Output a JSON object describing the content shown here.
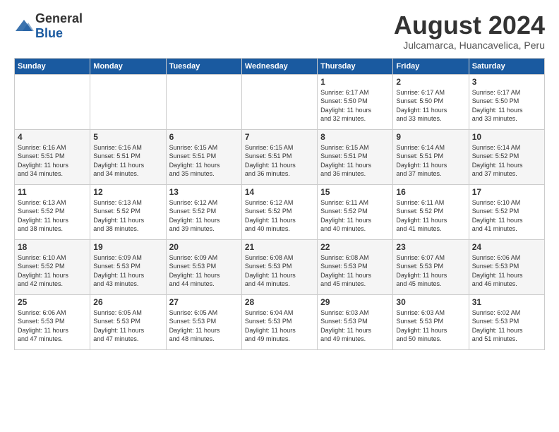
{
  "logo": {
    "general": "General",
    "blue": "Blue"
  },
  "header": {
    "month": "August 2024",
    "location": "Julcamarca, Huancavelica, Peru"
  },
  "days_of_week": [
    "Sunday",
    "Monday",
    "Tuesday",
    "Wednesday",
    "Thursday",
    "Friday",
    "Saturday"
  ],
  "weeks": [
    [
      {
        "num": "",
        "info": ""
      },
      {
        "num": "",
        "info": ""
      },
      {
        "num": "",
        "info": ""
      },
      {
        "num": "",
        "info": ""
      },
      {
        "num": "1",
        "info": "Sunrise: 6:17 AM\nSunset: 5:50 PM\nDaylight: 11 hours\nand 32 minutes."
      },
      {
        "num": "2",
        "info": "Sunrise: 6:17 AM\nSunset: 5:50 PM\nDaylight: 11 hours\nand 33 minutes."
      },
      {
        "num": "3",
        "info": "Sunrise: 6:17 AM\nSunset: 5:50 PM\nDaylight: 11 hours\nand 33 minutes."
      }
    ],
    [
      {
        "num": "4",
        "info": "Sunrise: 6:16 AM\nSunset: 5:51 PM\nDaylight: 11 hours\nand 34 minutes."
      },
      {
        "num": "5",
        "info": "Sunrise: 6:16 AM\nSunset: 5:51 PM\nDaylight: 11 hours\nand 34 minutes."
      },
      {
        "num": "6",
        "info": "Sunrise: 6:15 AM\nSunset: 5:51 PM\nDaylight: 11 hours\nand 35 minutes."
      },
      {
        "num": "7",
        "info": "Sunrise: 6:15 AM\nSunset: 5:51 PM\nDaylight: 11 hours\nand 36 minutes."
      },
      {
        "num": "8",
        "info": "Sunrise: 6:15 AM\nSunset: 5:51 PM\nDaylight: 11 hours\nand 36 minutes."
      },
      {
        "num": "9",
        "info": "Sunrise: 6:14 AM\nSunset: 5:51 PM\nDaylight: 11 hours\nand 37 minutes."
      },
      {
        "num": "10",
        "info": "Sunrise: 6:14 AM\nSunset: 5:52 PM\nDaylight: 11 hours\nand 37 minutes."
      }
    ],
    [
      {
        "num": "11",
        "info": "Sunrise: 6:13 AM\nSunset: 5:52 PM\nDaylight: 11 hours\nand 38 minutes."
      },
      {
        "num": "12",
        "info": "Sunrise: 6:13 AM\nSunset: 5:52 PM\nDaylight: 11 hours\nand 38 minutes."
      },
      {
        "num": "13",
        "info": "Sunrise: 6:12 AM\nSunset: 5:52 PM\nDaylight: 11 hours\nand 39 minutes."
      },
      {
        "num": "14",
        "info": "Sunrise: 6:12 AM\nSunset: 5:52 PM\nDaylight: 11 hours\nand 40 minutes."
      },
      {
        "num": "15",
        "info": "Sunrise: 6:11 AM\nSunset: 5:52 PM\nDaylight: 11 hours\nand 40 minutes."
      },
      {
        "num": "16",
        "info": "Sunrise: 6:11 AM\nSunset: 5:52 PM\nDaylight: 11 hours\nand 41 minutes."
      },
      {
        "num": "17",
        "info": "Sunrise: 6:10 AM\nSunset: 5:52 PM\nDaylight: 11 hours\nand 41 minutes."
      }
    ],
    [
      {
        "num": "18",
        "info": "Sunrise: 6:10 AM\nSunset: 5:52 PM\nDaylight: 11 hours\nand 42 minutes."
      },
      {
        "num": "19",
        "info": "Sunrise: 6:09 AM\nSunset: 5:53 PM\nDaylight: 11 hours\nand 43 minutes."
      },
      {
        "num": "20",
        "info": "Sunrise: 6:09 AM\nSunset: 5:53 PM\nDaylight: 11 hours\nand 44 minutes."
      },
      {
        "num": "21",
        "info": "Sunrise: 6:08 AM\nSunset: 5:53 PM\nDaylight: 11 hours\nand 44 minutes."
      },
      {
        "num": "22",
        "info": "Sunrise: 6:08 AM\nSunset: 5:53 PM\nDaylight: 11 hours\nand 45 minutes."
      },
      {
        "num": "23",
        "info": "Sunrise: 6:07 AM\nSunset: 5:53 PM\nDaylight: 11 hours\nand 45 minutes."
      },
      {
        "num": "24",
        "info": "Sunrise: 6:06 AM\nSunset: 5:53 PM\nDaylight: 11 hours\nand 46 minutes."
      }
    ],
    [
      {
        "num": "25",
        "info": "Sunrise: 6:06 AM\nSunset: 5:53 PM\nDaylight: 11 hours\nand 47 minutes."
      },
      {
        "num": "26",
        "info": "Sunrise: 6:05 AM\nSunset: 5:53 PM\nDaylight: 11 hours\nand 47 minutes."
      },
      {
        "num": "27",
        "info": "Sunrise: 6:05 AM\nSunset: 5:53 PM\nDaylight: 11 hours\nand 48 minutes."
      },
      {
        "num": "28",
        "info": "Sunrise: 6:04 AM\nSunset: 5:53 PM\nDaylight: 11 hours\nand 49 minutes."
      },
      {
        "num": "29",
        "info": "Sunrise: 6:03 AM\nSunset: 5:53 PM\nDaylight: 11 hours\nand 49 minutes."
      },
      {
        "num": "30",
        "info": "Sunrise: 6:03 AM\nSunset: 5:53 PM\nDaylight: 11 hours\nand 50 minutes."
      },
      {
        "num": "31",
        "info": "Sunrise: 6:02 AM\nSunset: 5:53 PM\nDaylight: 11 hours\nand 51 minutes."
      }
    ]
  ]
}
